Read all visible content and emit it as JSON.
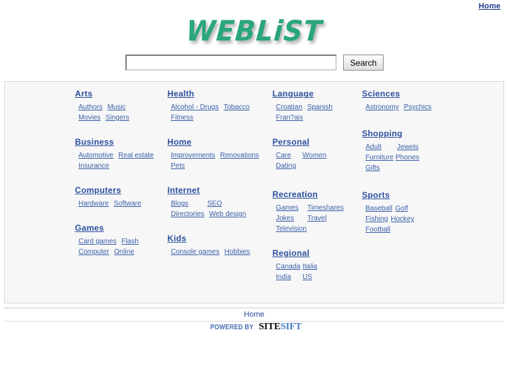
{
  "topbar": {
    "home_label": "Home"
  },
  "logo": {
    "text_upper": "WEBL",
    "text_lower": "i",
    "text_tail": "ST",
    "full": "WEBLiST",
    "color": "#2aa67c"
  },
  "search": {
    "value": "",
    "placeholder": "",
    "button_label": "Search"
  },
  "directory": {
    "columns": [
      {
        "categories": [
          {
            "title": "Arts",
            "links": [
              "Authors",
              "Music",
              "Movies",
              "Singers"
            ]
          },
          {
            "title": "Business",
            "links": [
              "Automotive",
              "Real estate",
              "Insurance"
            ]
          },
          {
            "title": "Computers",
            "links": [
              "Hardware",
              "Software"
            ]
          },
          {
            "title": "Games",
            "links": [
              "Card games",
              "Flash",
              "Computer",
              "Online"
            ]
          }
        ]
      },
      {
        "categories": [
          {
            "title": "Health",
            "links": [
              "Alcohol - Drugs",
              "Tobacco",
              "Fitness"
            ]
          },
          {
            "title": "Home",
            "links": [
              "Improvements",
              "Renovations",
              "Pets"
            ]
          },
          {
            "title": "Internet",
            "links": [
              "Blogs",
              "SEO",
              "Directories",
              "Web design"
            ]
          },
          {
            "title": "Kids",
            "links": [
              "Console games",
              "Hobbies"
            ]
          }
        ]
      },
      {
        "categories": [
          {
            "title": "Language",
            "links": [
              "Croatian",
              "Spanish",
              "Fran?ais"
            ]
          },
          {
            "title": "Personal",
            "links": [
              "Care",
              "Women",
              "Dating"
            ]
          },
          {
            "title": "Recreation",
            "links": [
              "Games",
              "Timeshares",
              "Jokes",
              "Travel",
              "Television"
            ]
          },
          {
            "title": "Regional",
            "links": [
              "Canada",
              "Italia",
              "India",
              "US"
            ]
          }
        ]
      },
      {
        "categories": [
          {
            "title": "Sciences",
            "links": [
              "Astronomy",
              "Psychics"
            ]
          },
          {
            "title": "Shopping",
            "links": [
              "Adult",
              "Jewels",
              "Furniture",
              "Phones",
              "Gifts"
            ]
          },
          {
            "title": "Sports",
            "links": [
              "Baseball",
              "Golf",
              "Fishing",
              "Hockey",
              "Football"
            ]
          }
        ]
      }
    ]
  },
  "footer": {
    "home_label": "Home",
    "powered_by": "POWERED BY",
    "brand_dark": "SITE",
    "brand_blue": "SIFT"
  }
}
